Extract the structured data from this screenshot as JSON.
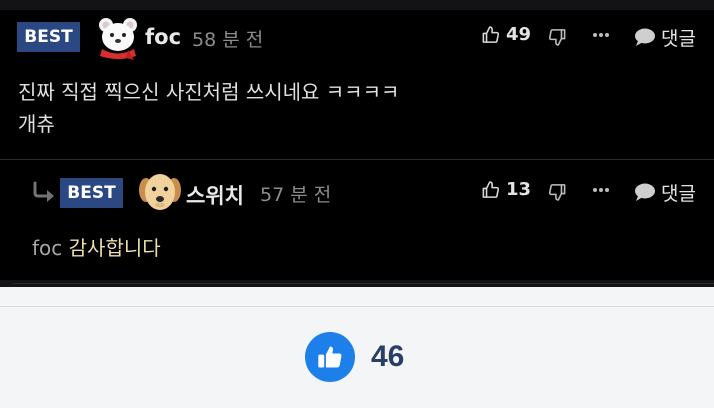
{
  "colors": {
    "best_badge": "#2b4882",
    "like_button": "#1d7fea",
    "like_count": "#283f66",
    "reply_text": "#eddfb0"
  },
  "comments": [
    {
      "badge": "BEST",
      "nickname": "foc",
      "time": "58 분 전",
      "likes": "49",
      "reply_label": "댓글",
      "avatar": "polar-bear-avatar",
      "lines": [
        "진짜 직접 찍으신 사진처럼 쓰시네요 ㅋㅋㅋㅋ",
        "개츄"
      ]
    },
    {
      "badge": "BEST",
      "nickname": "스위치",
      "time": "57 분 전",
      "likes": "13",
      "reply_label": "댓글",
      "avatar": "puppy-avatar",
      "mention": "foc",
      "text": "감사합니다"
    }
  ],
  "post_like": {
    "count": "46",
    "icon": "thumbs-up-icon"
  }
}
